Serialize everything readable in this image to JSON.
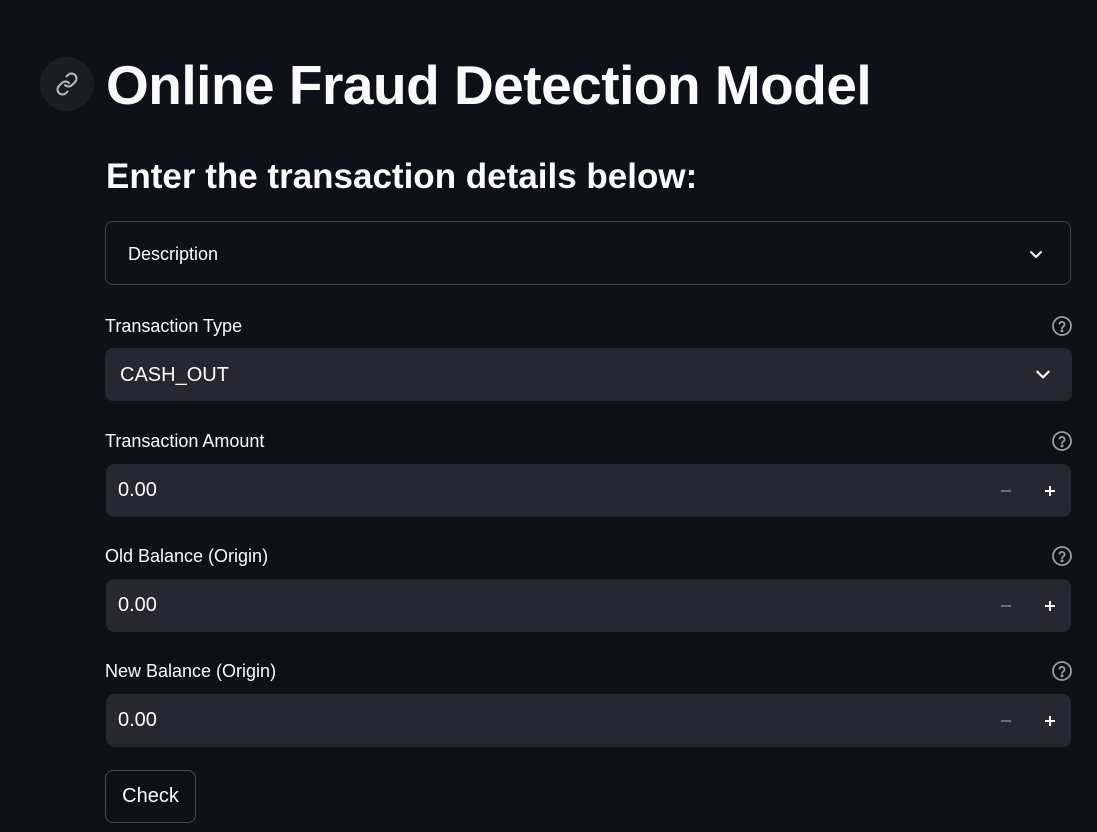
{
  "header": {
    "title": "Online Fraud Detection Model",
    "anchor_icon": "link-icon"
  },
  "form": {
    "subtitle": "Enter the transaction details below:",
    "description_expander": {
      "label": "Description",
      "icon": "chevron-down-icon"
    },
    "transaction_type": {
      "label": "Transaction Type",
      "value": "CASH_OUT",
      "help_icon": "help-circle-icon"
    },
    "transaction_amount": {
      "label": "Transaction Amount",
      "value": "0.00",
      "help_icon": "help-circle-icon"
    },
    "old_balance_origin": {
      "label": "Old Balance (Origin)",
      "value": "0.00",
      "help_icon": "help-circle-icon"
    },
    "new_balance_origin": {
      "label": "New Balance (Origin)",
      "value": "0.00",
      "help_icon": "help-circle-icon"
    },
    "check_button": "Check"
  },
  "colors": {
    "background": "#0e1117",
    "input_background": "#262730",
    "text": "#fafafa",
    "muted_icon": "#9a9ca3"
  }
}
